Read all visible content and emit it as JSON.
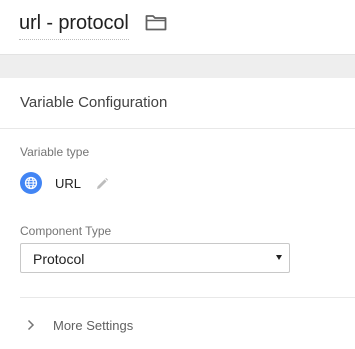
{
  "header": {
    "title": "url - protocol",
    "folder_icon": "folder-icon"
  },
  "variable_configuration": {
    "section_title": "Variable Configuration",
    "variable_type": {
      "label": "Variable type",
      "value": "URL",
      "icon": "globe-icon",
      "icon_color": "#4285f4",
      "edit_icon": "pencil-icon"
    },
    "component_type": {
      "label": "Component Type",
      "selected": "Protocol"
    },
    "more_settings": {
      "label": "More Settings",
      "icon": "chevron-right-icon"
    }
  }
}
